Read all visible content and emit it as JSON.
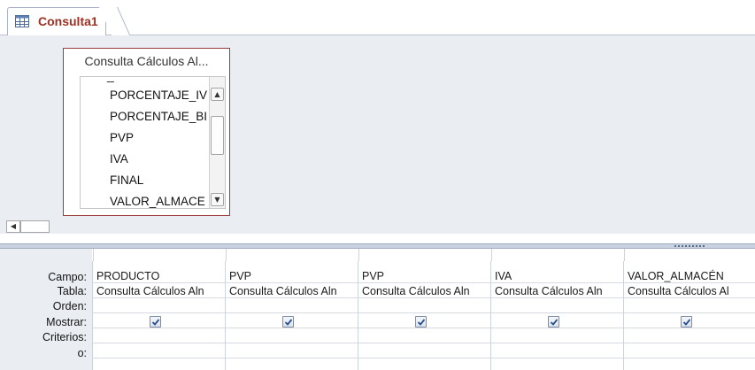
{
  "tab": {
    "label": "Consulta1",
    "icon": "query-icon"
  },
  "table_box": {
    "title": "Consulta Cálculos Al...",
    "fields": [
      "PORCENTAJE_IV",
      "PORCENTAJE_BI",
      "PVP",
      "IVA",
      "FINAL",
      "VALOR_ALMACE"
    ]
  },
  "row_labels": {
    "campo": "Campo:",
    "tabla": "Tabla:",
    "orden": "Orden:",
    "mostrar": "Mostrar:",
    "criterios": "Criterios:",
    "o": "o:"
  },
  "columns": [
    {
      "campo": "PRODUCTO",
      "tabla": "Consulta Cálculos Aln",
      "orden": "",
      "mostrar": true,
      "criterios": "",
      "o": ""
    },
    {
      "campo": "PVP",
      "tabla": "Consulta Cálculos Aln",
      "orden": "",
      "mostrar": true,
      "criterios": "",
      "o": ""
    },
    {
      "campo": "PVP",
      "tabla": "Consulta Cálculos Aln",
      "orden": "",
      "mostrar": true,
      "criterios": "",
      "o": ""
    },
    {
      "campo": "IVA",
      "tabla": "Consulta Cálculos Aln",
      "orden": "",
      "mostrar": true,
      "criterios": "",
      "o": ""
    },
    {
      "campo": "VALOR_ALMACÉN",
      "tabla": "Consulta Cálculos Al",
      "orden": "",
      "mostrar": true,
      "criterios": "",
      "o": ""
    }
  ],
  "colors": {
    "accent_tab": "#9b3122",
    "table_border": "#9a3c3c",
    "pane_bg": "#eaeef3"
  }
}
